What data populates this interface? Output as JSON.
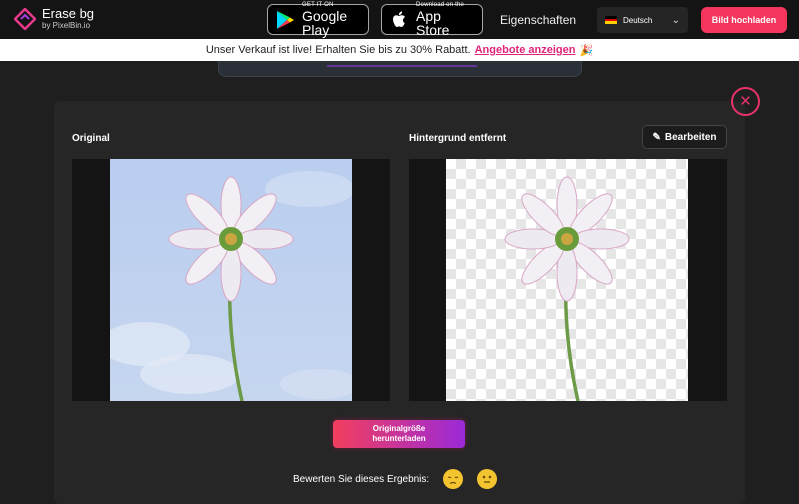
{
  "nav": {
    "logo_title": "Erase bg",
    "logo_sub": "by PixelBin.io",
    "google_play": {
      "small": "GET IT ON",
      "big": "Google Play"
    },
    "app_store": {
      "small": "Download on the",
      "big": "App Store"
    },
    "features_link": "Eigenschaften",
    "language": "Deutsch",
    "upload_button": "Bild hochladen"
  },
  "promo": {
    "text": "Unser Verkauf ist live! Erhalten Sie bis zu 30% Rabatt.",
    "link": "Angebote anzeigen"
  },
  "result": {
    "original_label": "Original",
    "removed_label": "Hintergrund entfernt",
    "edit_button": "Bearbeiten",
    "download_line1": "Originalgröße",
    "download_line2": "herunterladen",
    "rate_label": "Bewerten Sie dieses Ergebnis:"
  },
  "colors": {
    "accent_pink": "#f5365c",
    "gradient_start": "#f23f5e",
    "gradient_end": "#9b29d8",
    "close_ring": "#e8336a",
    "promo_link": "#e0247a"
  },
  "icons": [
    "erase-bg-logo-icon",
    "google-play-icon",
    "apple-icon",
    "german-flag-icon",
    "chevron-down-icon",
    "close-icon",
    "pencil-icon",
    "sad-face-icon",
    "neutral-face-icon",
    "party-popper-icon"
  ]
}
